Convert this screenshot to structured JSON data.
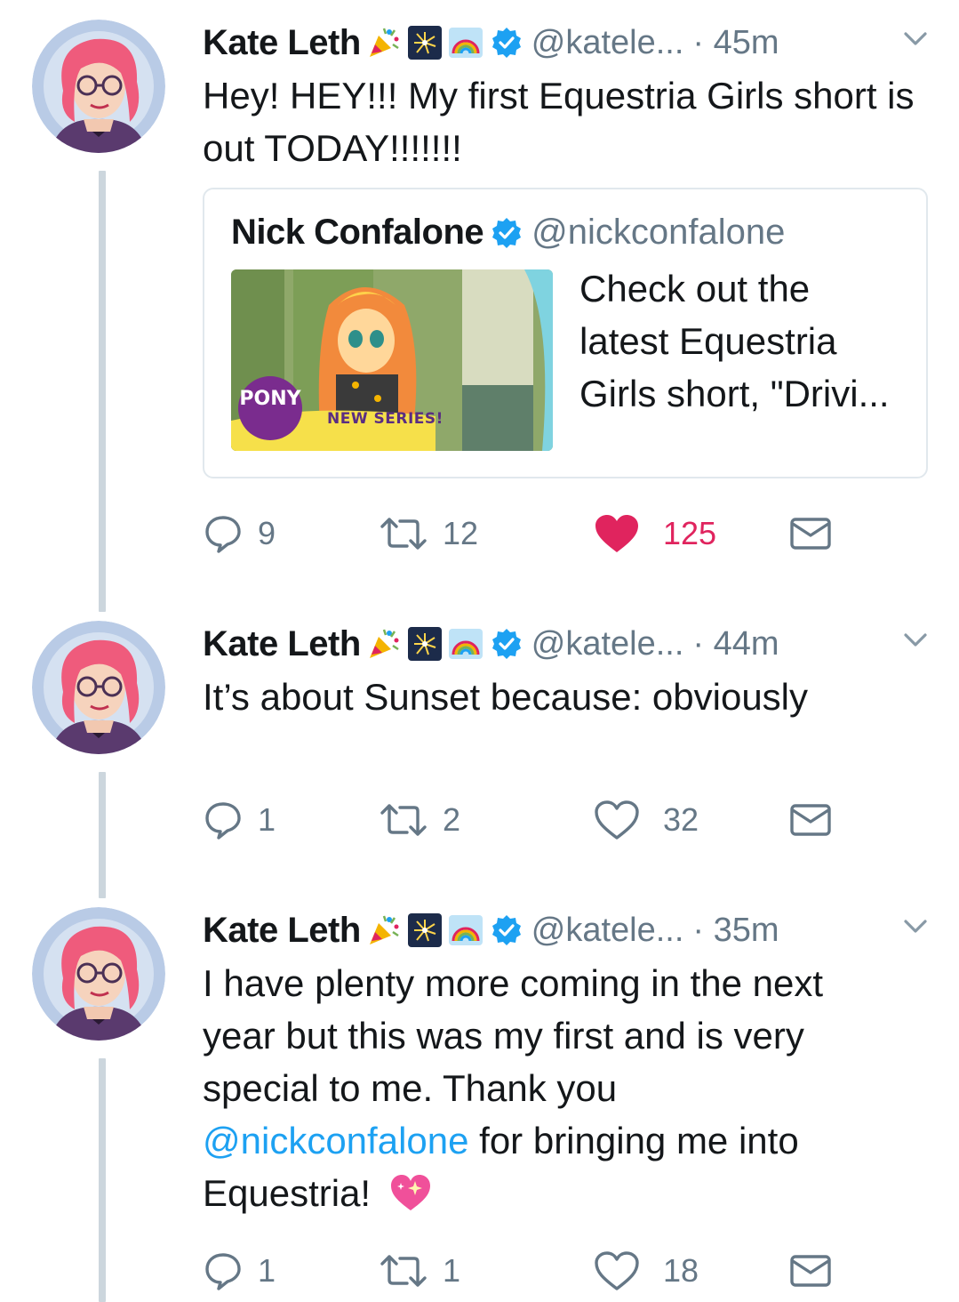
{
  "tweets": [
    {
      "name": "Kate Leth",
      "handle": "@katele...",
      "time": "· 45m",
      "text": "Hey! HEY!!! My first Equestria Girls short is out TODAY!!!!!!!",
      "quote": {
        "name": "Nick Confalone",
        "handle": "@nickconfalone",
        "text": "Check out the latest Equestria Girls short, \"Drivi...",
        "thumb_badge": "NEW SERIES!"
      },
      "replies": "9",
      "retweets": "12",
      "likes": "125",
      "liked": true
    },
    {
      "name": "Kate Leth",
      "handle": "@katele...",
      "time": "· 44m",
      "text": "It’s about Sunset because: obviously",
      "replies": "1",
      "retweets": "2",
      "likes": "32",
      "liked": false
    },
    {
      "name": "Kate Leth",
      "handle": "@katele...",
      "time": "· 35m",
      "text_before": "I have plenty more coming in the next year but this was my first and is very special to me. Thank you",
      "mention": "@nickconfalone",
      "text_after": "for bringing me into Equestria!",
      "replies": "1",
      "retweets": "1",
      "likes": "18",
      "liked": false
    }
  ],
  "icons": {
    "name_emojis": [
      "party-popper-icon",
      "fireworks-icon",
      "rainbow-icon"
    ],
    "verified": "verified-badge-icon",
    "reply": "reply-icon",
    "retweet": "retweet-icon",
    "like": "heart-icon",
    "dm": "envelope-icon",
    "sparkling_heart": "sparkling-heart-icon"
  },
  "colors": {
    "accent": "#1da1f2",
    "like_active": "#e0245e",
    "muted": "#657786",
    "thread_line": "#ccd6dd"
  }
}
